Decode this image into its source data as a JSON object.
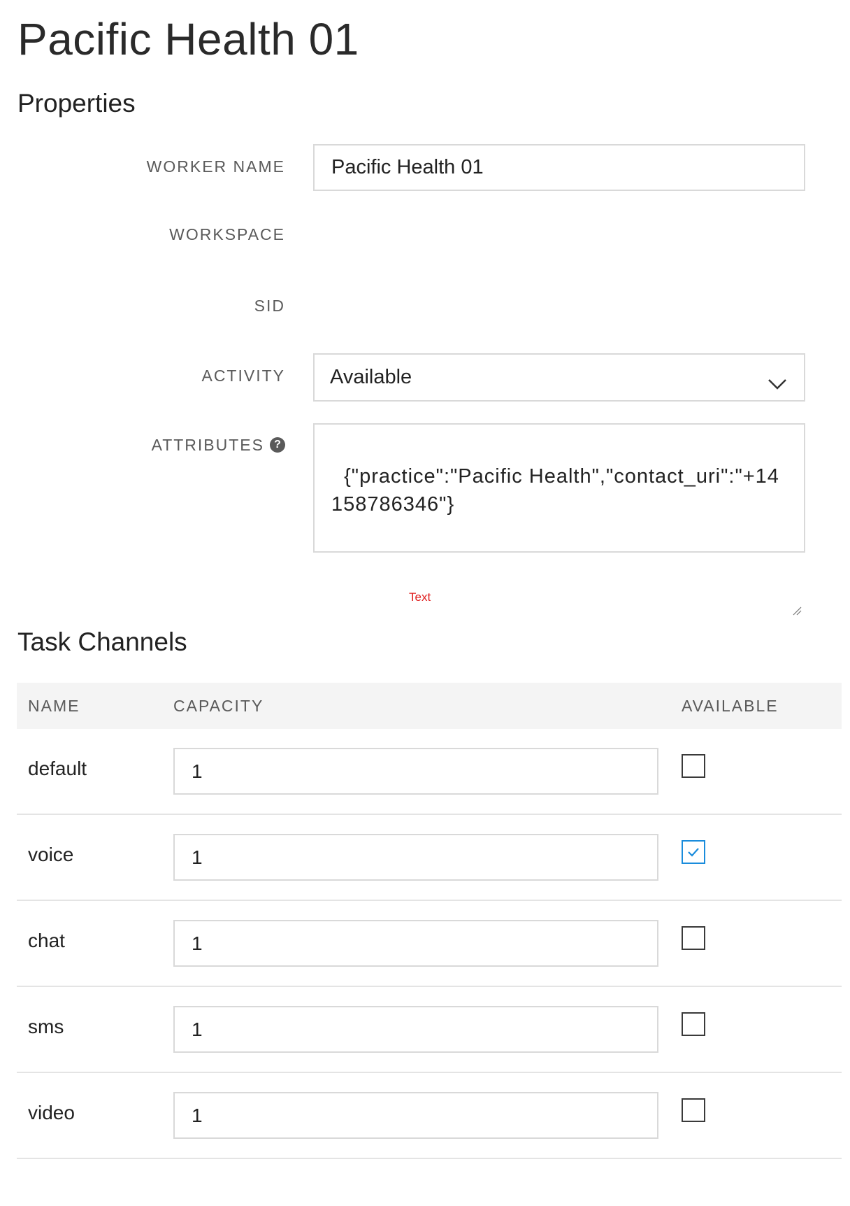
{
  "page": {
    "title": "Pacific Health 01"
  },
  "properties": {
    "section_title": "Properties",
    "worker_name": {
      "label": "WORKER NAME",
      "value": "Pacific Health 01"
    },
    "workspace": {
      "label": "WORKSPACE",
      "value": ""
    },
    "sid": {
      "label": "SID",
      "value": ""
    },
    "activity": {
      "label": "ACTIVITY",
      "value": "Available",
      "icon": "chevron-down-icon"
    },
    "attributes": {
      "label": "ATTRIBUTES",
      "help_icon": "?",
      "value": "{\"practice\":\"Pacific Health\",\"contact_uri\":\"+14158786346\"}"
    }
  },
  "annotation": {
    "text": "Text",
    "color": "#e01e1e"
  },
  "task_channels": {
    "section_title": "Task Channels",
    "columns": {
      "name": "NAME",
      "capacity": "CAPACITY",
      "available": "AVAILABLE"
    },
    "rows": [
      {
        "name": "default",
        "capacity": "1",
        "available": false
      },
      {
        "name": "voice",
        "capacity": "1",
        "available": true
      },
      {
        "name": "chat",
        "capacity": "1",
        "available": false
      },
      {
        "name": "sms",
        "capacity": "1",
        "available": false
      },
      {
        "name": "video",
        "capacity": "1",
        "available": false
      }
    ]
  },
  "colors": {
    "accent": "#1a8cdc",
    "border": "#d9d9d9",
    "header_bg": "#f4f4f4"
  }
}
